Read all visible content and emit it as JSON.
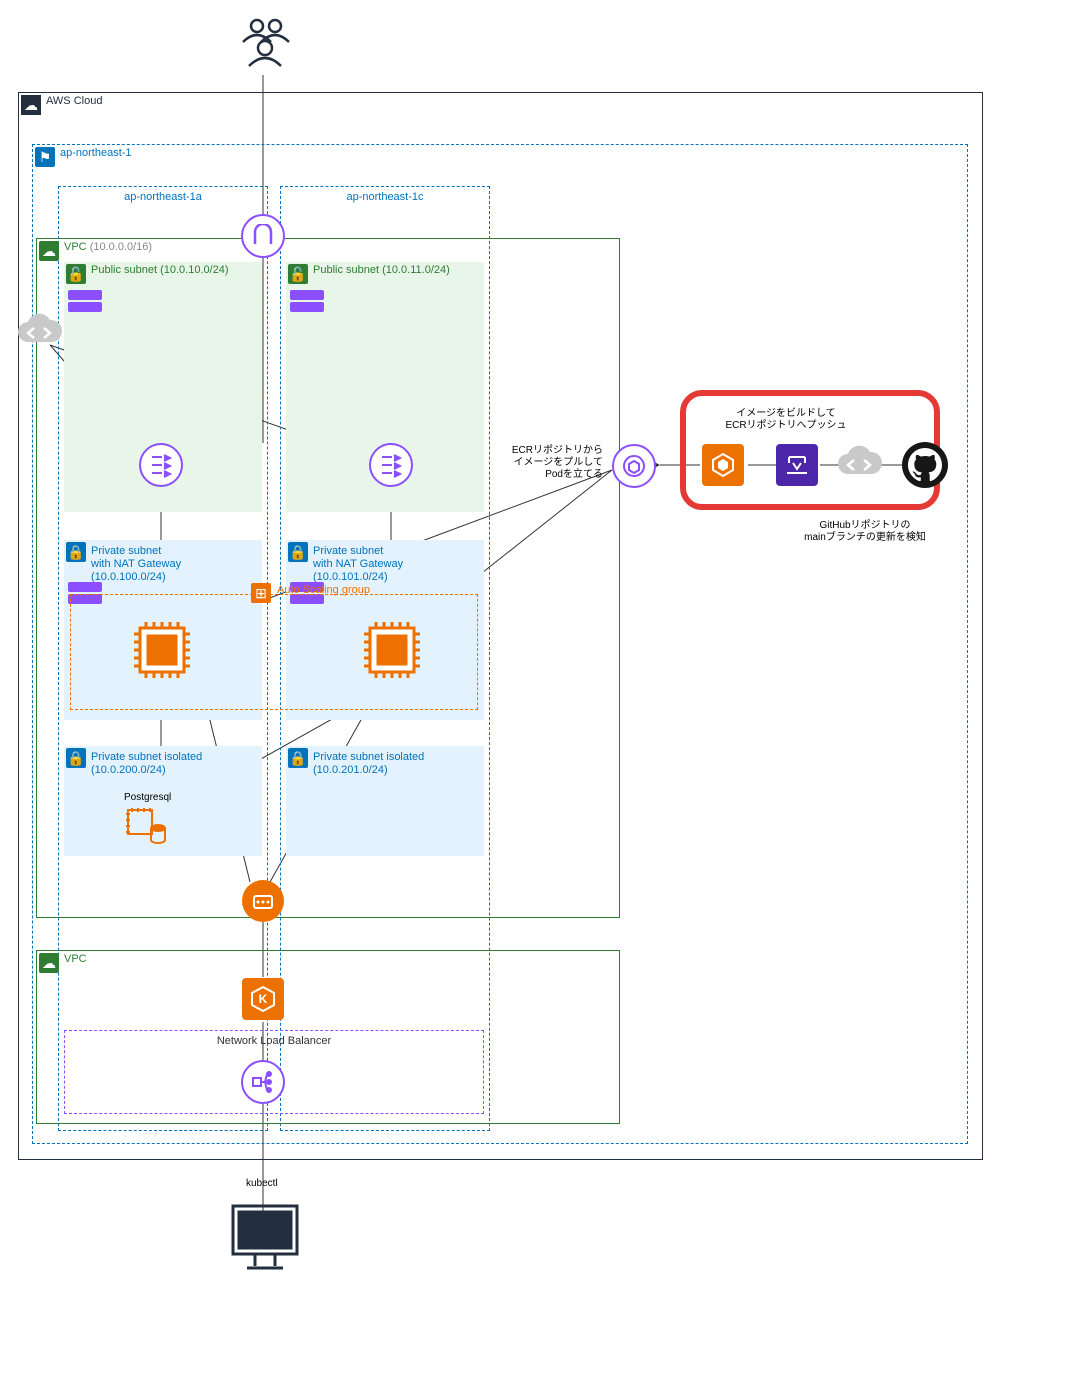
{
  "cloud": {
    "label": "AWS Cloud"
  },
  "region": {
    "label": "ap-northeast-1"
  },
  "az_a": {
    "label": "ap-northeast-1a"
  },
  "az_c": {
    "label": "ap-northeast-1c"
  },
  "vpc1": {
    "label": "VPC",
    "cidr": "(10.0.0.0/16)"
  },
  "vpc2": {
    "label": "VPC"
  },
  "pubsubnet_a": {
    "label": "Public subnet (10.0.10.0/24)"
  },
  "pubsubnet_c": {
    "label": "Public subnet (10.0.11.0/24)"
  },
  "privnat_a": {
    "label1": "Private subnet",
    "label2": "with NAT Gateway",
    "label3": "(10.0.100.0/24)"
  },
  "privnat_c": {
    "label1": "Private subnet",
    "label2": "with NAT Gateway",
    "label3": "(10.0.101.0/24)"
  },
  "priviso_a": {
    "label1": "Private subnet isolated",
    "label2": "(10.0.200.0/24)"
  },
  "priviso_c": {
    "label1": "Private subnet isolated",
    "label2": "(10.0.201.0/24)"
  },
  "asg": {
    "label": "Auto Scaling group"
  },
  "nlb": {
    "label": "Network Load Balancer"
  },
  "postgresql": {
    "label": "Postgresql"
  },
  "ecr_note": {
    "l1": "ECRリポジトリから",
    "l2": "イメージをプルして",
    "l3": "Podを立てる"
  },
  "build_note": {
    "l1": "イメージをビルドして",
    "l2": "ECRリポジトリへプッシュ"
  },
  "github_note": {
    "l1": "GitHubリポジトリの",
    "l2": "mainブランチの更新を検知"
  },
  "kubectl": {
    "label": "kubectl"
  }
}
